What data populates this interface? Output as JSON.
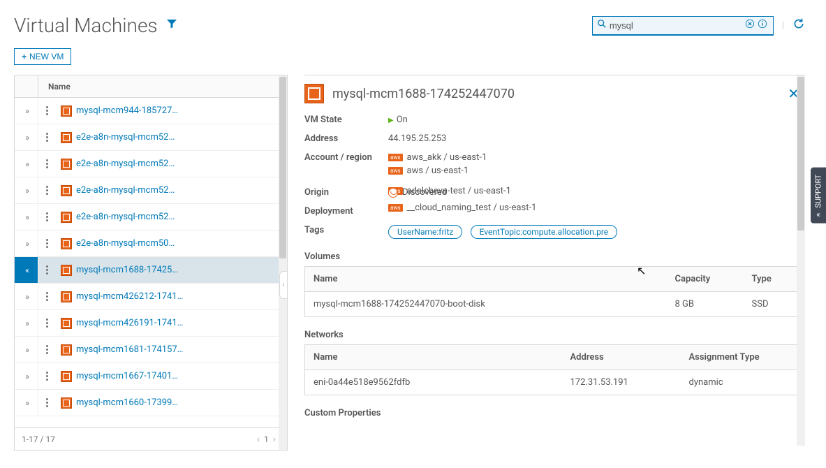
{
  "header": {
    "title": "Virtual Machines",
    "new_vm": "NEW VM",
    "search_value": "mysql"
  },
  "list": {
    "name_header": "Name",
    "items": [
      {
        "name": "mysql-mcm944-185727…"
      },
      {
        "name": "e2e-a8n-mysql-mcm52…"
      },
      {
        "name": "e2e-a8n-mysql-mcm52…"
      },
      {
        "name": "e2e-a8n-mysql-mcm52…"
      },
      {
        "name": "e2e-a8n-mysql-mcm52…"
      },
      {
        "name": "e2e-a8n-mysql-mcm50…"
      },
      {
        "name": "mysql-mcm1688-17425…"
      },
      {
        "name": "mysql-mcm426212-1741…"
      },
      {
        "name": "mysql-mcm426191-1741…"
      },
      {
        "name": "mysql-mcm1681-174157…"
      },
      {
        "name": "mysql-mcm1667-17401…"
      },
      {
        "name": "mysql-mcm1660-17399…"
      }
    ],
    "footer_count": "1-17 / 17",
    "page": "1"
  },
  "detail": {
    "title": "mysql-mcm1688-174252447070",
    "labels": {
      "state": "VM State",
      "address": "Address",
      "account": "Account / region",
      "origin": "Origin",
      "deployment": "Deployment",
      "tags": "Tags",
      "volumes": "Volumes",
      "networks": "Networks",
      "custom": "Custom Properties"
    },
    "state": "On",
    "address": "44.195.25.253",
    "accounts": [
      "aws_akk / us-east-1",
      "aws / us-east-1",
      "adelcheva-test / us-east-1",
      "__cloud_naming_test / us-east-1"
    ],
    "origin": "Discovered",
    "tags": [
      "UserName:fritz",
      "EventTopic:compute.allocation.pre"
    ],
    "volumes": {
      "headers": {
        "name": "Name",
        "capacity": "Capacity",
        "type": "Type"
      },
      "rows": [
        {
          "name": "mysql-mcm1688-174252447070-boot-disk",
          "capacity": "8 GB",
          "type": "SSD"
        }
      ]
    },
    "networks": {
      "headers": {
        "name": "Name",
        "address": "Address",
        "assign": "Assignment Type"
      },
      "rows": [
        {
          "name": "eni-0a44e518e9562fdfb",
          "address": "172.31.53.191",
          "assign": "dynamic"
        }
      ]
    }
  },
  "support": "SUPPORT"
}
